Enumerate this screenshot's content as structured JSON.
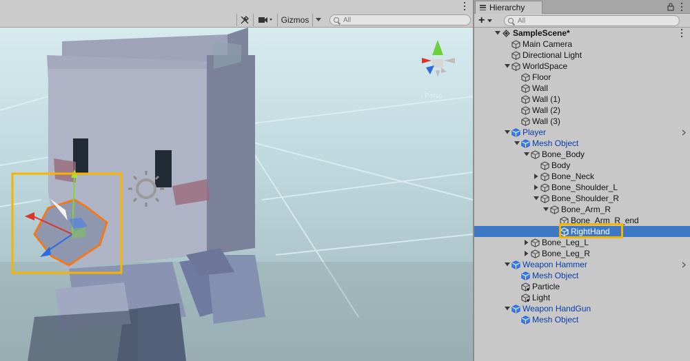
{
  "scene": {
    "toolbar": {
      "gizmos_label": "Gizmos",
      "search_placeholder": "All"
    }
  },
  "hierarchy": {
    "tab_label": "Hierarchy",
    "add_label": "+",
    "search_placeholder": "All",
    "items": [
      {
        "label": "SampleScene*",
        "depth": 0,
        "expanded": true,
        "kind": "scene"
      },
      {
        "label": "Main Camera",
        "depth": 1,
        "kind": "object"
      },
      {
        "label": "Directional Light",
        "depth": 1,
        "kind": "object"
      },
      {
        "label": "WorldSpace",
        "depth": 1,
        "expanded": true,
        "kind": "object"
      },
      {
        "label": "Floor",
        "depth": 2,
        "kind": "object"
      },
      {
        "label": "Wall",
        "depth": 2,
        "kind": "object"
      },
      {
        "label": "Wall (1)",
        "depth": 2,
        "kind": "object"
      },
      {
        "label": "Wall (2)",
        "depth": 2,
        "kind": "object"
      },
      {
        "label": "Wall (3)",
        "depth": 2,
        "kind": "object"
      },
      {
        "label": "Player",
        "depth": 1,
        "expanded": true,
        "kind": "prefab",
        "has_override_arrow": true
      },
      {
        "label": "Mesh Object",
        "depth": 2,
        "expanded": true,
        "kind": "prefab"
      },
      {
        "label": "Bone_Body",
        "depth": 3,
        "expanded": true,
        "kind": "object"
      },
      {
        "label": "Body",
        "depth": 4,
        "kind": "object"
      },
      {
        "label": "Bone_Neck",
        "depth": 4,
        "collapsed": true,
        "kind": "object"
      },
      {
        "label": "Bone_Shoulder_L",
        "depth": 4,
        "collapsed": true,
        "kind": "object"
      },
      {
        "label": "Bone_Shoulder_R",
        "depth": 4,
        "expanded": true,
        "kind": "object"
      },
      {
        "label": "Bone_Arm_R",
        "depth": 5,
        "expanded": true,
        "kind": "object"
      },
      {
        "label": "Bone_Arm_R_end",
        "depth": 6,
        "kind": "object"
      },
      {
        "label": "RightHand",
        "depth": 6,
        "kind": "object",
        "selected": true
      },
      {
        "label": "Bone_Leg_L",
        "depth": 3,
        "collapsed": true,
        "kind": "object"
      },
      {
        "label": "Bone_Leg_R",
        "depth": 3,
        "collapsed": true,
        "kind": "object"
      },
      {
        "label": "Weapon Hammer",
        "depth": 1,
        "expanded": true,
        "kind": "prefab",
        "has_override_arrow": true
      },
      {
        "label": "Mesh Object",
        "depth": 2,
        "kind": "prefab"
      },
      {
        "label": "Particle",
        "depth": 2,
        "kind": "object-added"
      },
      {
        "label": "Light",
        "depth": 2,
        "kind": "object-added"
      },
      {
        "label": "Weapon HandGun",
        "depth": 1,
        "expanded": true,
        "kind": "prefab"
      },
      {
        "label": "Mesh Object",
        "depth": 2,
        "kind": "prefab"
      }
    ]
  },
  "colors": {
    "selection": "#3d78c5",
    "prefab_text": "#0b3aa8",
    "highlight": "#f5b400",
    "selection_outline": "#f07a1a"
  }
}
